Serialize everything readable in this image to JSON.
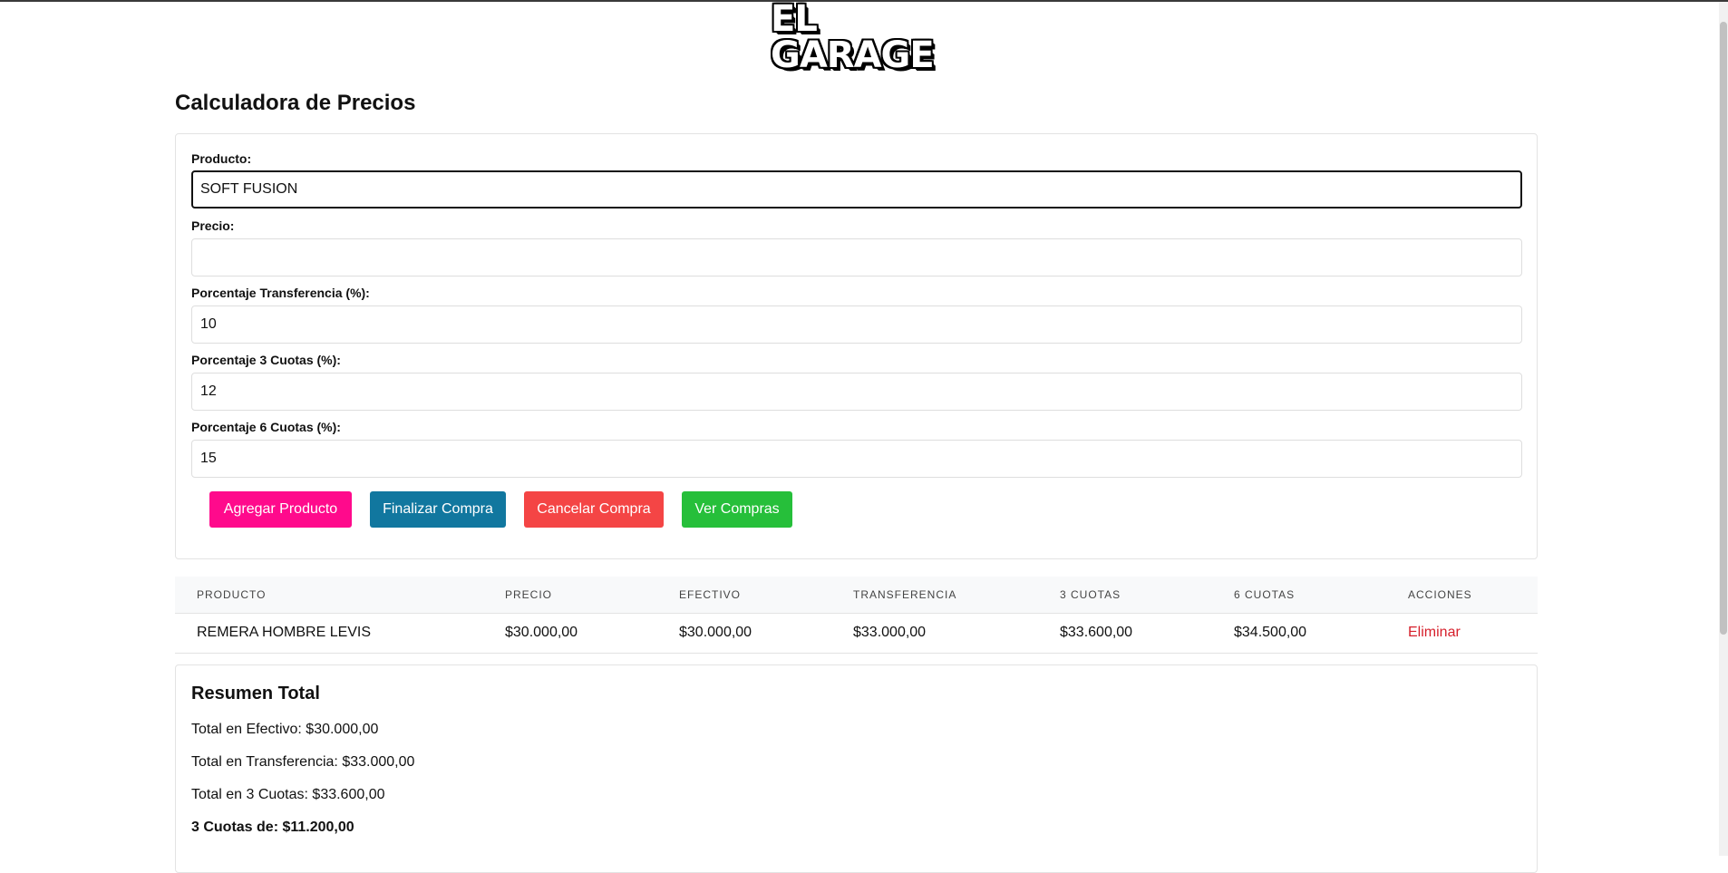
{
  "logo": {
    "text": "EL GARAGE"
  },
  "page": {
    "title": "Calculadora de Precios"
  },
  "form": {
    "producto": {
      "label": "Producto:",
      "value": "SOFT FUSION",
      "placeholder": ""
    },
    "precio": {
      "label": "Precio:",
      "value": "",
      "placeholder": ""
    },
    "transferencia": {
      "label": "Porcentaje Transferencia (%):",
      "value": "10"
    },
    "cuotas3": {
      "label": "Porcentaje 3 Cuotas (%):",
      "value": "12"
    },
    "cuotas6": {
      "label": "Porcentaje 6 Cuotas (%):",
      "value": "15"
    }
  },
  "buttons": {
    "agregar": "Agregar Producto",
    "finalizar": "Finalizar Compra",
    "cancelar": "Cancelar Compra",
    "ver": "Ver Compras"
  },
  "table": {
    "headers": [
      "PRODUCTO",
      "PRECIO",
      "EFECTIVO",
      "TRANSFERENCIA",
      "3 CUOTAS",
      "6 CUOTAS",
      "ACCIONES"
    ],
    "rows": [
      {
        "producto": "REMERA HOMBRE LEVIS",
        "precio": "$30.000,00",
        "efectivo": "$30.000,00",
        "transferencia": "$33.000,00",
        "cuotas3": "$33.600,00",
        "cuotas6": "$34.500,00",
        "accion": "Eliminar"
      }
    ]
  },
  "summary": {
    "title": "Resumen Total",
    "efectivo": "Total en Efectivo: $30.000,00",
    "transferencia": "Total en Transferencia: $33.000,00",
    "cuotas3_total": "Total en 3 Cuotas: $33.600,00",
    "cuotas3_de": "3 Cuotas de: $11.200,00"
  },
  "colors": {
    "agregar": "#ff0a8c",
    "finalizar": "#11779f",
    "cancelar": "#f44545",
    "ver": "#26bf3a",
    "eliminar": "#d61f2b"
  }
}
